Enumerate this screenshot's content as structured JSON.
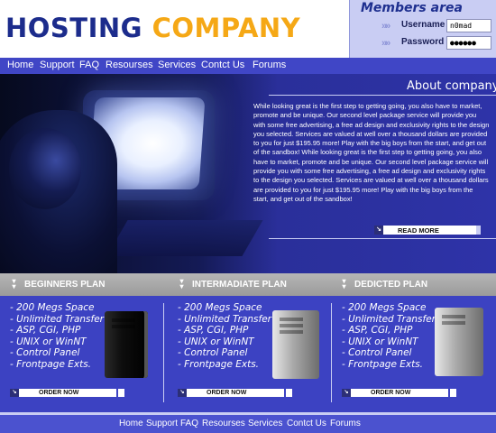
{
  "logo": {
    "word1": "HOSTING",
    "word2": "COMPANY"
  },
  "members": {
    "title": "Members area",
    "username_label": "Username",
    "username_value": "n0mad",
    "password_label": "Password",
    "password_value": "●●●●●●"
  },
  "topnav": [
    "Home",
    "Support",
    "FAQ",
    "Resourses",
    "Services",
    "Contct Us",
    "Forums"
  ],
  "about": {
    "title": "About company",
    "text": "While looking great is the first step to getting going, you also have to market, promote and be unique. Our second level package service will provide you with some free advertising, a free ad design and exclusivity rights to the design you selected. Services are valued at well over a thousand dollars are provided to you for just $195.95 more! Play with the big boys from the start, and get out of the sandbox! While looking great is the first step to getting going, you also have to market, promote and be unique. Our second level package service will provide you with some free advertising, a free ad design and exclusivity rights to the design you selected. Services are valued at well over a thousand dollars are provided to you for just $195.95 more! Play with the big boys from the start, and get out of the sandbox!",
    "read_more": "READ MORE"
  },
  "plans": [
    {
      "title": "BEGINNERS PLAN",
      "features": [
        "- 200 Megs Space",
        "- Unlimited Transfer",
        "- ASP, CGI, PHP",
        "- UNIX or WinNT",
        "- Control Panel",
        "- Frontpage Exts."
      ],
      "order": "ORDER NOW",
      "server_color": "black"
    },
    {
      "title": "INTERMADIATE PLAN",
      "features": [
        "- 200 Megs Space",
        "- Unlimited Transfer",
        "- ASP, CGI, PHP",
        "- UNIX or WinNT",
        "- Control Panel",
        "- Frontpage Exts."
      ],
      "order": "ORDER NOW",
      "server_color": "silver"
    },
    {
      "title": "DEDICTED PLAN",
      "features": [
        "- 200 Megs Space",
        "- Unlimited Transfer",
        "- ASP, CGI, PHP",
        "- UNIX or WinNT",
        "- Control Panel",
        "- Frontpage Exts."
      ],
      "order": "ORDER NOW",
      "server_color": "silver"
    }
  ],
  "footer": [
    "Home",
    "Support",
    "FAQ",
    "Resourses",
    "Services",
    "Contct Us",
    "Forums"
  ],
  "colors": {
    "brand_navy": "#1c2c8c",
    "brand_orange": "#f5a816",
    "nav_blue": "#4046c6",
    "panel_lavender": "#c9cdf3"
  }
}
